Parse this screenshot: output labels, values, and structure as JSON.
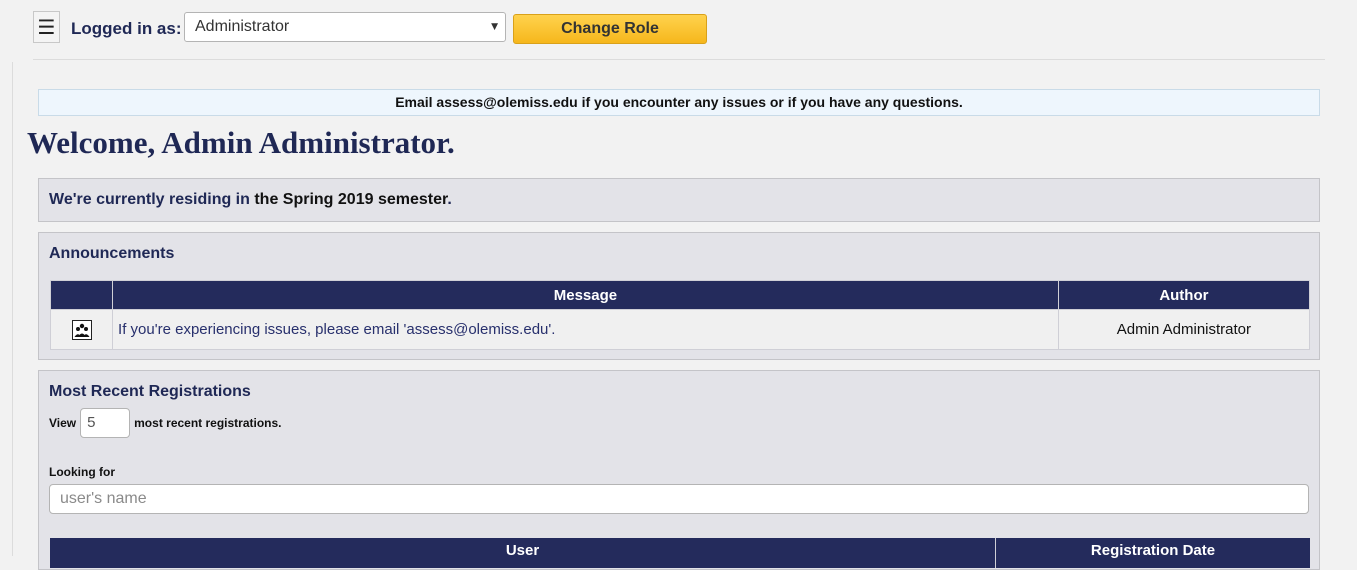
{
  "topbar": {
    "menu_icon": "hamburger-icon",
    "logged_in_label": "Logged in as:",
    "role_value": "Administrator",
    "change_role_label": "Change Role"
  },
  "notice": "Email assess@olemiss.edu if you encounter any issues or if you have any questions.",
  "welcome": "Welcome, Admin Administrator.",
  "semester": {
    "prefix": "We're currently residing in ",
    "highlight": "the Spring 2019 semester",
    "suffix": "."
  },
  "announcements": {
    "title": "Announcements",
    "columns": [
      "",
      "Message",
      "Author"
    ],
    "rows": [
      {
        "icon": "group-icon",
        "message": "If you're experiencing issues, please email 'assess@olemiss.edu'.",
        "author": "Admin Administrator"
      }
    ]
  },
  "registrations": {
    "title": "Most Recent Registrations",
    "view_prefix": "View",
    "count": "5",
    "view_suffix": "most recent registrations.",
    "looking_for_label": "Looking for",
    "search_placeholder": "user's name",
    "columns": [
      "User",
      "Registration Date"
    ]
  },
  "colors": {
    "navy": "#242b5c",
    "heading": "#1f2855",
    "button": "#f6b71c",
    "panel": "#e3e3e8"
  }
}
